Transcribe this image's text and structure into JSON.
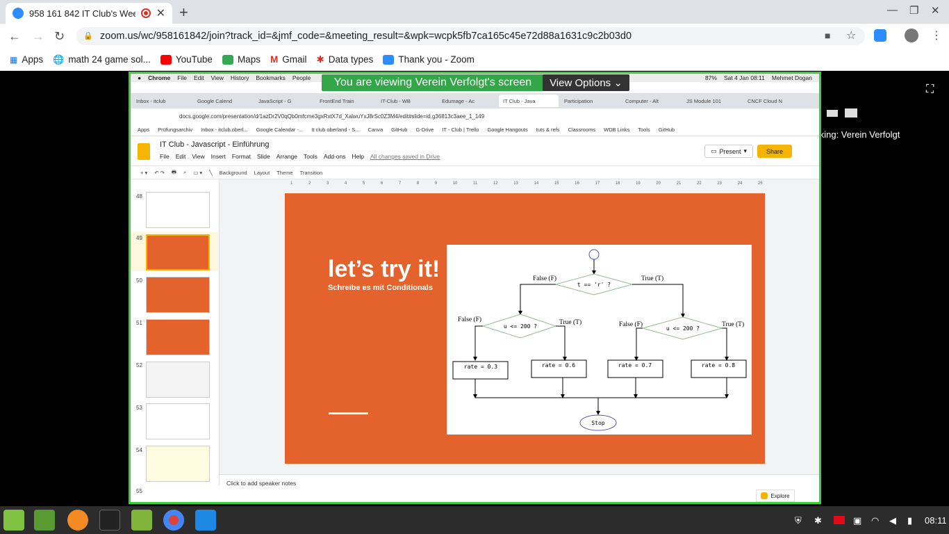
{
  "browser": {
    "tab_title": "958 161 842 IT Club's Wee",
    "new_tab": "+",
    "url": "zoom.us/wc/958161842/join?track_id=&jmf_code=&meeting_result=&wpk=wcpk5fb7ca165c45e72d88a1631c9c2b03d0",
    "bookmarks": [
      "Apps",
      "math 24 game sol...",
      "YouTube",
      "Maps",
      "Gmail",
      "Data types",
      "Thank you - Zoom"
    ]
  },
  "zoom": {
    "viewing_text": "You are viewing Verein Verfolgt's screen",
    "view_options": "View Options",
    "talking": "talking:  Verein Verfolgt"
  },
  "mac": {
    "menu": [
      "Chrome",
      "File",
      "Edit",
      "View",
      "History",
      "Bookmarks",
      "People"
    ],
    "right": [
      "87%",
      "Sat 4 Jan  08:11",
      "Mehmet Dogan"
    ]
  },
  "inner": {
    "tabs": [
      "Inbox - itclub",
      "Google Calend",
      "JavaScript - G",
      "FrontEnd Train",
      "IT-Club - WB",
      "Edumage - Ac",
      "IT Club - Java",
      "Participation",
      "Computer - Alt",
      "JS Module 101",
      "CNCF Cloud N"
    ],
    "url": "docs.google.com/presentation/d/1azDr2V0qQb0mfcme3gxRxtX7d_XalwuYxJ8rSc0Z3M4/edit#slide=id.g36813c3aee_1_149",
    "bookmarks": [
      "Apps",
      "Prüfungsarchiv",
      "Inbox - itclub.oberl...",
      "Google Calendar -...",
      "It club oberland - S...",
      "Canva",
      "GitHub",
      "G-Drive",
      "IT - Club | Trello",
      "Google Hangouts",
      "tuts & refs",
      "Classrooms",
      "WDB Links",
      "Tools",
      "GitHub"
    ]
  },
  "docs": {
    "title": "IT Club - Javascript - Einführung",
    "menu": [
      "File",
      "Edit",
      "View",
      "Insert",
      "Format",
      "Slide",
      "Arrange",
      "Tools",
      "Add-ons",
      "Help"
    ],
    "saved": "All changes saved in Drive",
    "present": "Present",
    "share": "Share",
    "toolbar": [
      "Background",
      "Layout",
      "Theme",
      "Transition"
    ],
    "slide_numbers": [
      "48",
      "49",
      "50",
      "51",
      "52",
      "53",
      "54",
      "55"
    ],
    "ruler": [
      "1",
      "2",
      "3",
      "4",
      "5",
      "6",
      "7",
      "8",
      "9",
      "10",
      "11",
      "12",
      "13",
      "14",
      "15",
      "16",
      "17",
      "18",
      "19",
      "20",
      "21",
      "22",
      "23",
      "24",
      "25"
    ],
    "notes": "Click to add speaker notes",
    "explore": "Explore"
  },
  "slide": {
    "title": "let’s try it!",
    "subtitle": "Schreibe es mit Conditionals",
    "flowchart": {
      "cond1": "t == 'r' ?",
      "cond2": "u <= 200 ?",
      "cond3": "u <= 200 ?",
      "false1": "False (F)",
      "true1": "True (T)",
      "false2": "False (F)",
      "true2": "True (T)",
      "false3": "False (F)",
      "true3": "True (T)",
      "rate1": "rate = 0.3",
      "rate2": "rate = 0.6",
      "rate3": "rate = 0.7",
      "rate4": "rate = 0.8",
      "stop": "Stop"
    }
  },
  "taskbar": {
    "clock": "08:11"
  }
}
